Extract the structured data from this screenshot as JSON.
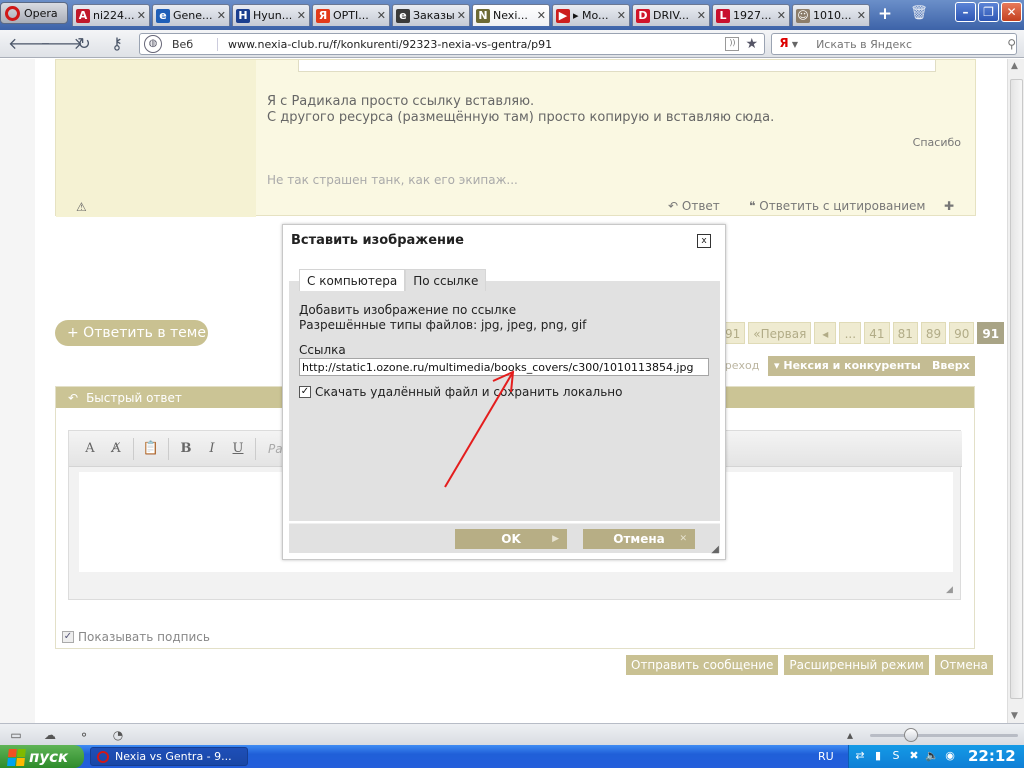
{
  "browser": {
    "menu_label": "Opera",
    "tabs": [
      {
        "title": "ni224...",
        "fav": "A",
        "fav_color": "#c0182a"
      },
      {
        "title": "Gene...",
        "fav": "e",
        "fav_color": "#1f5fb8"
      },
      {
        "title": "Hyun...",
        "fav": "H",
        "fav_color": "#1b3f8f"
      },
      {
        "title": "OPTI...",
        "fav": "Я",
        "fav_color": "#e23a1a"
      },
      {
        "title": "Заказы",
        "fav": "e",
        "fav_color": "#3a3a3a"
      },
      {
        "title": "Nexi...",
        "fav": "N",
        "fav_color": "#6d6a35"
      },
      {
        "title": "▸ Mo...",
        "fav": "▶",
        "fav_color": "#cc1e1e"
      },
      {
        "title": "DRIV...",
        "fav": "D",
        "fav_color": "#d0142a"
      },
      {
        "title": "1927...",
        "fav": "L",
        "fav_color": "#c8102e"
      },
      {
        "title": "1010...",
        "fav": "☺",
        "fav_color": "#8c7d6a"
      }
    ],
    "address": {
      "label": "Веб",
      "url": "www.nexia-club.ru/f/konkurenti/92323-nexia-vs-gentra/p91"
    },
    "search": {
      "engine": "Я",
      "placeholder": "Искать в Яндекс"
    }
  },
  "post": {
    "lines": [
      "Я с Радикала просто ссылку вставляю.",
      "С другого ресурса (размещённую там) просто копирую и вставляю сюда."
    ],
    "thanks": "Спасибо",
    "signature": "Не так страшен танк, как его экипаж...",
    "actions": {
      "reply": "Ответ",
      "quote": "Ответить с цитированием"
    }
  },
  "topic": {
    "reply_button": "+ Ответить в теме",
    "pager": [
      "91",
      "«Первая",
      "◂",
      "...",
      "41",
      "81",
      "89",
      "90",
      "91"
    ],
    "jump_label": "ереход",
    "forum_button": "Нексия и конкуренты",
    "up_button": "Вверх"
  },
  "quick_reply": {
    "title": "Быстрый ответ",
    "size_placeholder": "Разм",
    "show_signature": "Показывать подпись",
    "buttons": [
      "Отправить сообщение",
      "Расширенный режим",
      "Отмена"
    ]
  },
  "modal": {
    "title": "Вставить изображение",
    "close": "x",
    "tabs": [
      "С компьютера",
      "По ссылке"
    ],
    "active_tab": 1,
    "info_line1": "Добавить изображение по ссылке",
    "info_line2": "Разрешённые типы файлов: jpg, jpeg, png, gif",
    "link_label": "Ссылка",
    "link_value": "http://static1.ozone.ru/multimedia/books_covers/c300/1010113854.jpg",
    "download_label": "Скачать удалённый файл и сохранить локально",
    "ok": "OK",
    "cancel": "Отмена"
  },
  "taskbar": {
    "start": "пуск",
    "app": "Nexia vs Gentra - 9...",
    "lang": "RU",
    "clock": "22:12"
  },
  "colors": {
    "accent": "#c9c191",
    "arrow": "#e41d1d",
    "modal_body": "#e1e1e1"
  }
}
